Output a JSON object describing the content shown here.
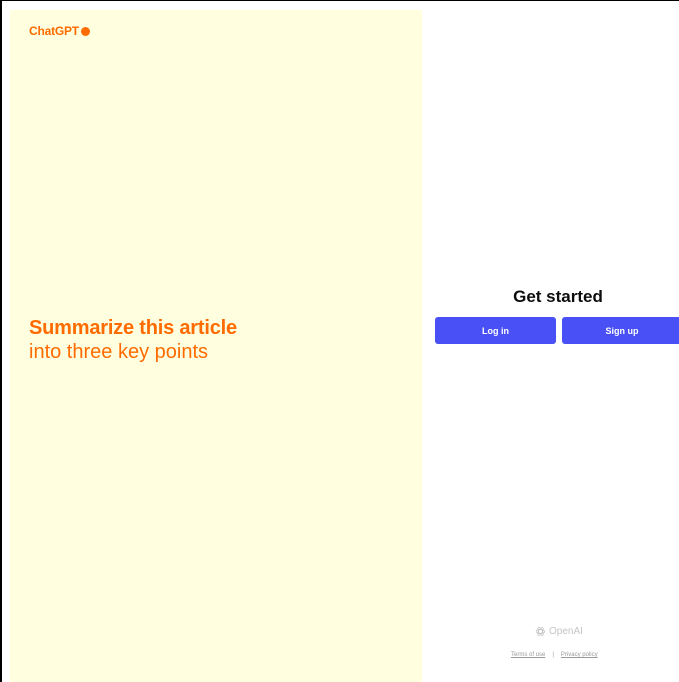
{
  "colors": {
    "accent": "#ff6b00",
    "panel_bg": "#ffffdf",
    "button_bg": "#4950f6"
  },
  "brand": {
    "name": "ChatGPT",
    "dot_icon": "dot-icon"
  },
  "promo": {
    "headline": "Summarize this article",
    "subline": "into three key points"
  },
  "auth": {
    "title": "Get started",
    "login_label": "Log in",
    "signup_label": "Sign up"
  },
  "footer": {
    "brand": "OpenAI",
    "brand_icon": "openai-logo-icon",
    "terms": "Terms of use",
    "separator": "|",
    "privacy": "Privacy policy"
  }
}
